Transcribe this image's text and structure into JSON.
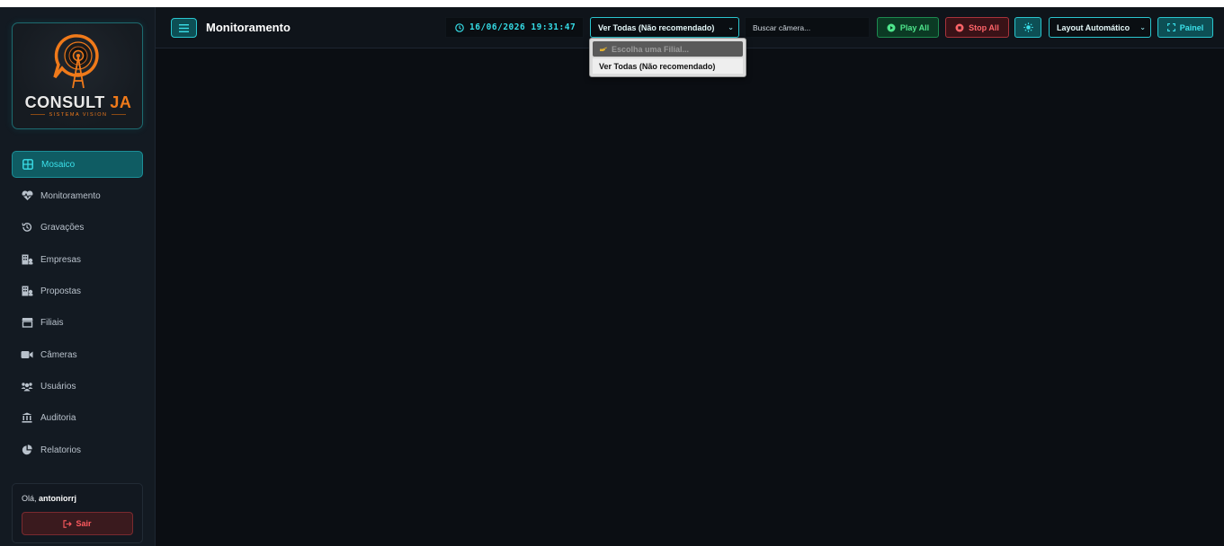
{
  "app": {
    "logo_word_white": "CONSULT",
    "logo_word_orange": "JA",
    "logo_subtitle": "SISTEMA VISION"
  },
  "sidebar": {
    "items": [
      {
        "label": "Mosaico",
        "icon": "grid-icon",
        "active": true
      },
      {
        "label": "Monitoramento",
        "icon": "heart-pulse-icon",
        "active": false
      },
      {
        "label": "Gravações",
        "icon": "history-icon",
        "active": false
      },
      {
        "label": "Empresas",
        "icon": "building-icon",
        "active": false
      },
      {
        "label": "Propostas",
        "icon": "building-icon",
        "active": false
      },
      {
        "label": "Filiais",
        "icon": "store-icon",
        "active": false
      },
      {
        "label": "Câmeras",
        "icon": "video-camera-icon",
        "active": false
      },
      {
        "label": "Usuários",
        "icon": "users-icon",
        "active": false
      },
      {
        "label": "Auditoria",
        "icon": "landmark-icon",
        "active": false
      },
      {
        "label": "Relatorios",
        "icon": "pie-chart-icon",
        "active": false
      }
    ],
    "user": {
      "greeting": "Olá,",
      "username": "antoniorrj",
      "logout_label": "Sair"
    }
  },
  "header": {
    "title": "Monitoramento",
    "clock": "16/06/2026 19:31:47",
    "branch_select": {
      "value": "Ver Todas (Não recomendado)",
      "options": [
        {
          "label": "Escolha uma Filial...",
          "disabled": true
        },
        {
          "label": "Ver Todas (Não recomendado)",
          "selected": true
        }
      ]
    },
    "search_placeholder": "Buscar câmera...",
    "play_all": "Play All",
    "stop_all": "Stop All",
    "layout_select": "Layout Automático",
    "panel_button": "Painel"
  },
  "colors": {
    "accent": "#2ac6cf",
    "brand_orange": "#f07a1a",
    "play_green": "#4ee68c",
    "stop_red": "#ff6469"
  }
}
